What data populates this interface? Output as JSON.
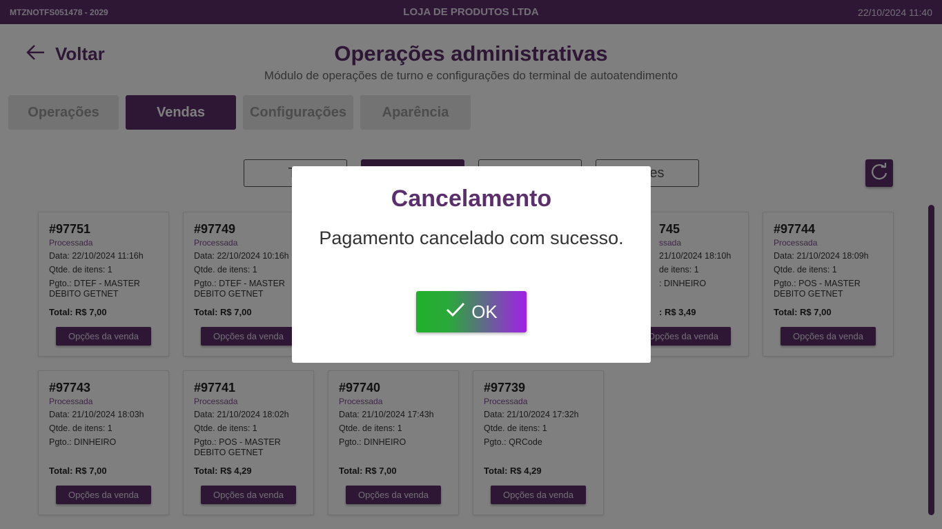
{
  "header": {
    "terminal": "MTZNOTFS051478 - 2029",
    "company": "LOJA DE PRODUTOS LTDA",
    "datetime": "22/10/2024 11:40"
  },
  "back_label": "Voltar",
  "page": {
    "title": "Operações administrativas",
    "subtitle": "Módulo de operações de turno e configurações do terminal de autoatendimento"
  },
  "tabs": [
    {
      "label": "Operações"
    },
    {
      "label": "Vendas"
    },
    {
      "label": "Configurações"
    },
    {
      "label": "Aparência"
    }
  ],
  "filters": [
    {
      "label": "To"
    },
    {
      "label": ""
    },
    {
      "label": ""
    },
    {
      "label": "entes"
    }
  ],
  "sales": [
    {
      "id": "#97751",
      "status": "Processada",
      "date": "Data: 22/10/2024 11:16h",
      "qty": "Qtde. de itens: 1",
      "payment": "Pgto.: DTEF - MASTER DEBITO GETNET",
      "total": "Total: R$ 7,00",
      "options": "Opções da venda"
    },
    {
      "id": "#97749",
      "status": "Processada",
      "date": "Data: 22/10/2024 10:16h",
      "qty": "Qtde. de itens: 1",
      "payment": "Pgto.: DTEF - MASTER DEBITO GETNET",
      "total": "Total: R$ 7,00",
      "options": "Opções da venda"
    },
    {
      "id": "745",
      "status": "ssada",
      "date": "21/10/2024 18:10h",
      "qty": "de itens: 1",
      "payment": ": DINHEIRO",
      "total": ": R$ 3,49",
      "options": "Opções da venda"
    },
    {
      "id": "#97744",
      "status": "Processada",
      "date": "Data: 21/10/2024 18:09h",
      "qty": "Qtde. de itens: 1",
      "payment": "Pgto.: POS - MASTER DEBITO GETNET",
      "total": "Total: R$ 7,00",
      "options": "Opções da venda"
    },
    {
      "id": "#97743",
      "status": "Processada",
      "date": "Data: 21/10/2024 18:03h",
      "qty": "Qtde. de itens: 1",
      "payment": "Pgto.: DINHEIRO",
      "total": "Total: R$ 7,00",
      "options": "Opções da venda"
    },
    {
      "id": "#97741",
      "status": "Processada",
      "date": "Data: 21/10/2024 18:02h",
      "qty": "Qtde. de itens: 1",
      "payment": "Pgto.: POS - MASTER DEBITO GETNET",
      "total": "Total: R$ 4,29",
      "options": "Opções da venda"
    },
    {
      "id": "#97740",
      "status": "Processada",
      "date": "Data: 21/10/2024 17:43h",
      "qty": "Qtde. de itens: 1",
      "payment": "Pgto.: DINHEIRO",
      "total": "Total: R$ 7,00",
      "options": "Opções da venda"
    },
    {
      "id": "#97739",
      "status": "Processada",
      "date": "Data: 21/10/2024 17:32h",
      "qty": "Qtde. de itens: 1",
      "payment": "Pgto.: QRCode",
      "total": "Total: R$ 4,29",
      "options": "Opções da venda"
    }
  ],
  "modal": {
    "title": "Cancelamento",
    "message": "Pagamento cancelado com sucesso.",
    "ok_label": "OK"
  },
  "colors": {
    "brand": "#5a2f6b",
    "ok_gradient_start": "#22b02a",
    "ok_gradient_end": "#a020e8"
  }
}
